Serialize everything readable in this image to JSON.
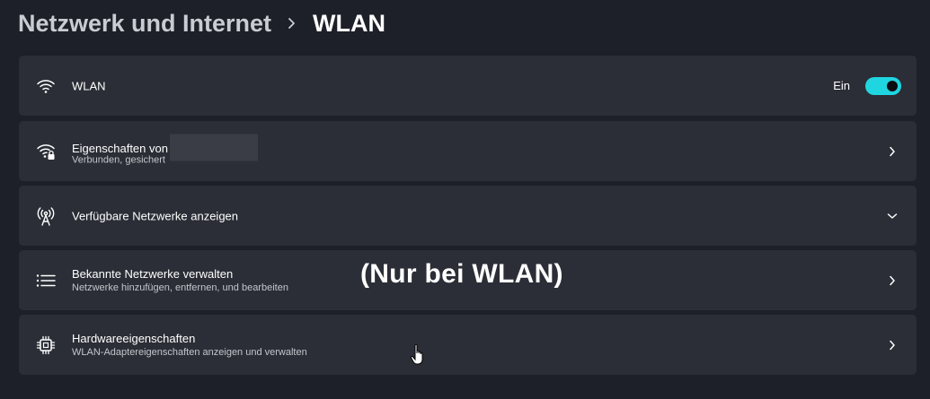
{
  "breadcrumb": {
    "parent": "Netzwerk und Internet",
    "current": "WLAN"
  },
  "cards": {
    "wlan": {
      "title": "WLAN",
      "icon": "wifi-icon",
      "toggle_label": "Ein",
      "toggle_on": true
    },
    "properties": {
      "title": "Eigenschaften von",
      "subtitle": "Verbunden, gesichert",
      "icon": "wifi-lock-icon"
    },
    "available": {
      "title": "Verfügbare Netzwerke anzeigen",
      "icon": "antenna-icon"
    },
    "known": {
      "title": "Bekannte Netzwerke verwalten",
      "subtitle": "Netzwerke hinzufügen, entfernen, und bearbeiten",
      "icon": "list-icon"
    },
    "hardware": {
      "title": "Hardwareeigenschaften",
      "subtitle": "WLAN-Adaptereigenschaften anzeigen und verwalten",
      "icon": "chip-icon"
    }
  },
  "annotation": "(Nur bei WLAN)",
  "colors": {
    "accent": "#1fd5e0",
    "card_bg": "#2b2e36",
    "page_bg": "#1d2028"
  }
}
